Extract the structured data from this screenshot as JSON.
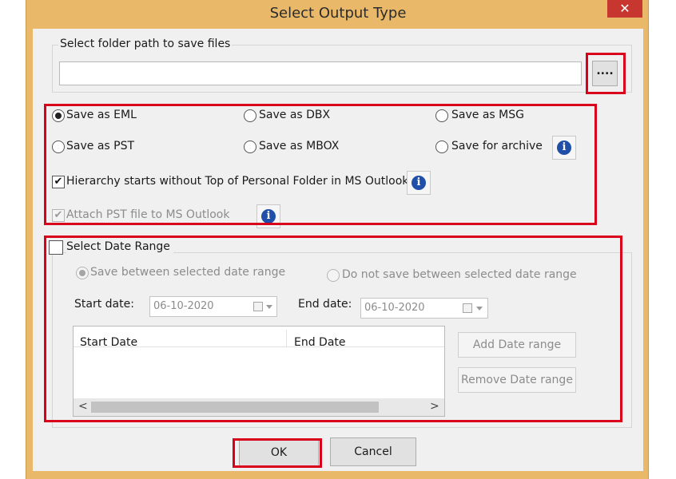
{
  "window": {
    "title": "Select Output Type",
    "close_symbol": "✕"
  },
  "folder": {
    "label": "Select folder path to save files",
    "path_value": "",
    "browse_label": "...."
  },
  "formats": {
    "save_eml": "Save as EML",
    "save_dbx": "Save as DBX",
    "save_msg": "Save as MSG",
    "save_pst": "Save as PST",
    "save_mbox": "Save as MBOX",
    "save_archive": "Save for archive",
    "selected": "save_eml"
  },
  "options": {
    "hierarchy_label": "Hierarchy starts without Top of Personal Folder in MS Outlook",
    "hierarchy_checked": true,
    "attach_pst_label": "Attach PST file to MS Outlook",
    "attach_pst_checked": true,
    "check_symbol": "✔",
    "info_symbol": "i"
  },
  "date_range": {
    "label": "Select Date Range",
    "checked": false,
    "save_between": "Save between selected date range",
    "do_not_save_between": "Do not save between selected date range",
    "start_label": "Start date:",
    "start_value": "06-10-2020",
    "end_label": "End date:",
    "end_value": "06-10-2020",
    "columns": [
      "Start Date",
      "End Date"
    ],
    "add_button": "Add Date range",
    "remove_button": "Remove Date range",
    "scroll_left": "<",
    "scroll_right": ">"
  },
  "footer": {
    "ok_label": "OK",
    "cancel_label": "Cancel"
  },
  "colors": {
    "title_bar": "#e9b868",
    "highlight": "#d9001b",
    "close": "#c7372f",
    "info": "#1f4fa8"
  },
  "icons": [
    "close-icon",
    "info-icon",
    "calendar-icon",
    "chevron-down-icon",
    "check-icon"
  ]
}
